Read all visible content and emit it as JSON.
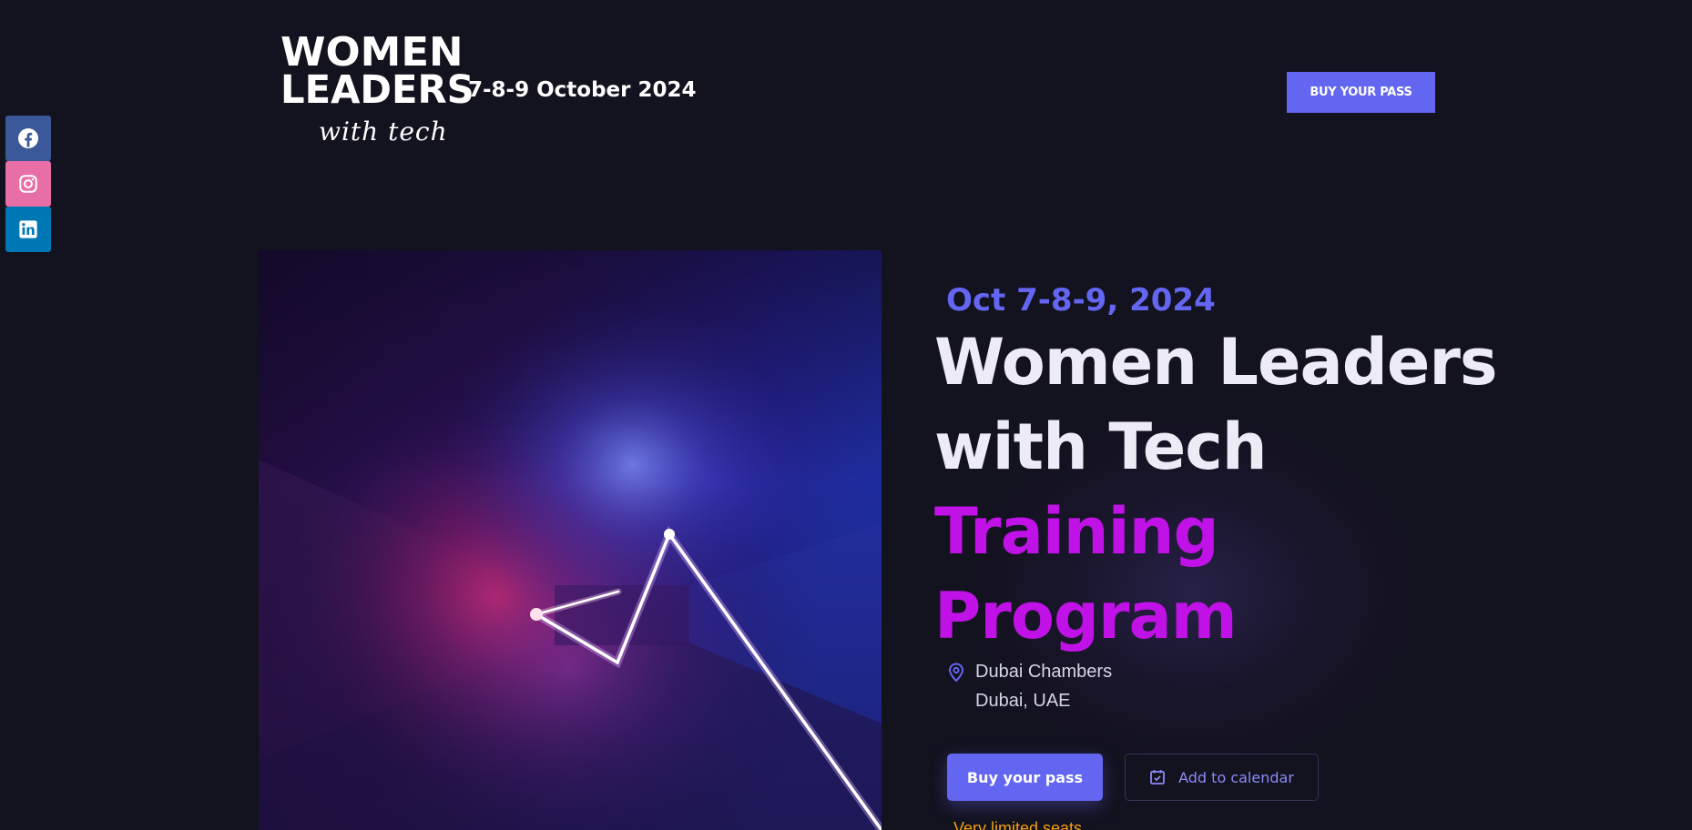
{
  "logo": {
    "line1": "WOMEN",
    "line2": "LEADERS",
    "script": "with tech",
    "dates": "7-8-9 October 2024"
  },
  "header": {
    "buy_label": "BUY YOUR PASS"
  },
  "social": {
    "items": [
      {
        "name": "facebook",
        "icon": "facebook-icon",
        "color": "#3b5998"
      },
      {
        "name": "instagram",
        "icon": "instagram-icon",
        "color": "#e86fa6"
      },
      {
        "name": "linkedin",
        "icon": "linkedin-icon",
        "color": "#0077b5"
      }
    ]
  },
  "hero": {
    "date": "Oct 7-8-9, 2024",
    "title_line1": "Women Leaders",
    "title_line2": "with Tech",
    "title_line3": "Training",
    "title_line4": "Program",
    "location_line1": "Dubai Chambers",
    "location_line2": "Dubai, UAE",
    "buy_label": "Buy your pass",
    "calendar_label": "Add to calendar",
    "seats_note": "Very limited seats"
  },
  "colors": {
    "background": "#13121f",
    "accent": "#6366f1",
    "title_highlight": "#c012e6",
    "note": "#f59e0b"
  }
}
